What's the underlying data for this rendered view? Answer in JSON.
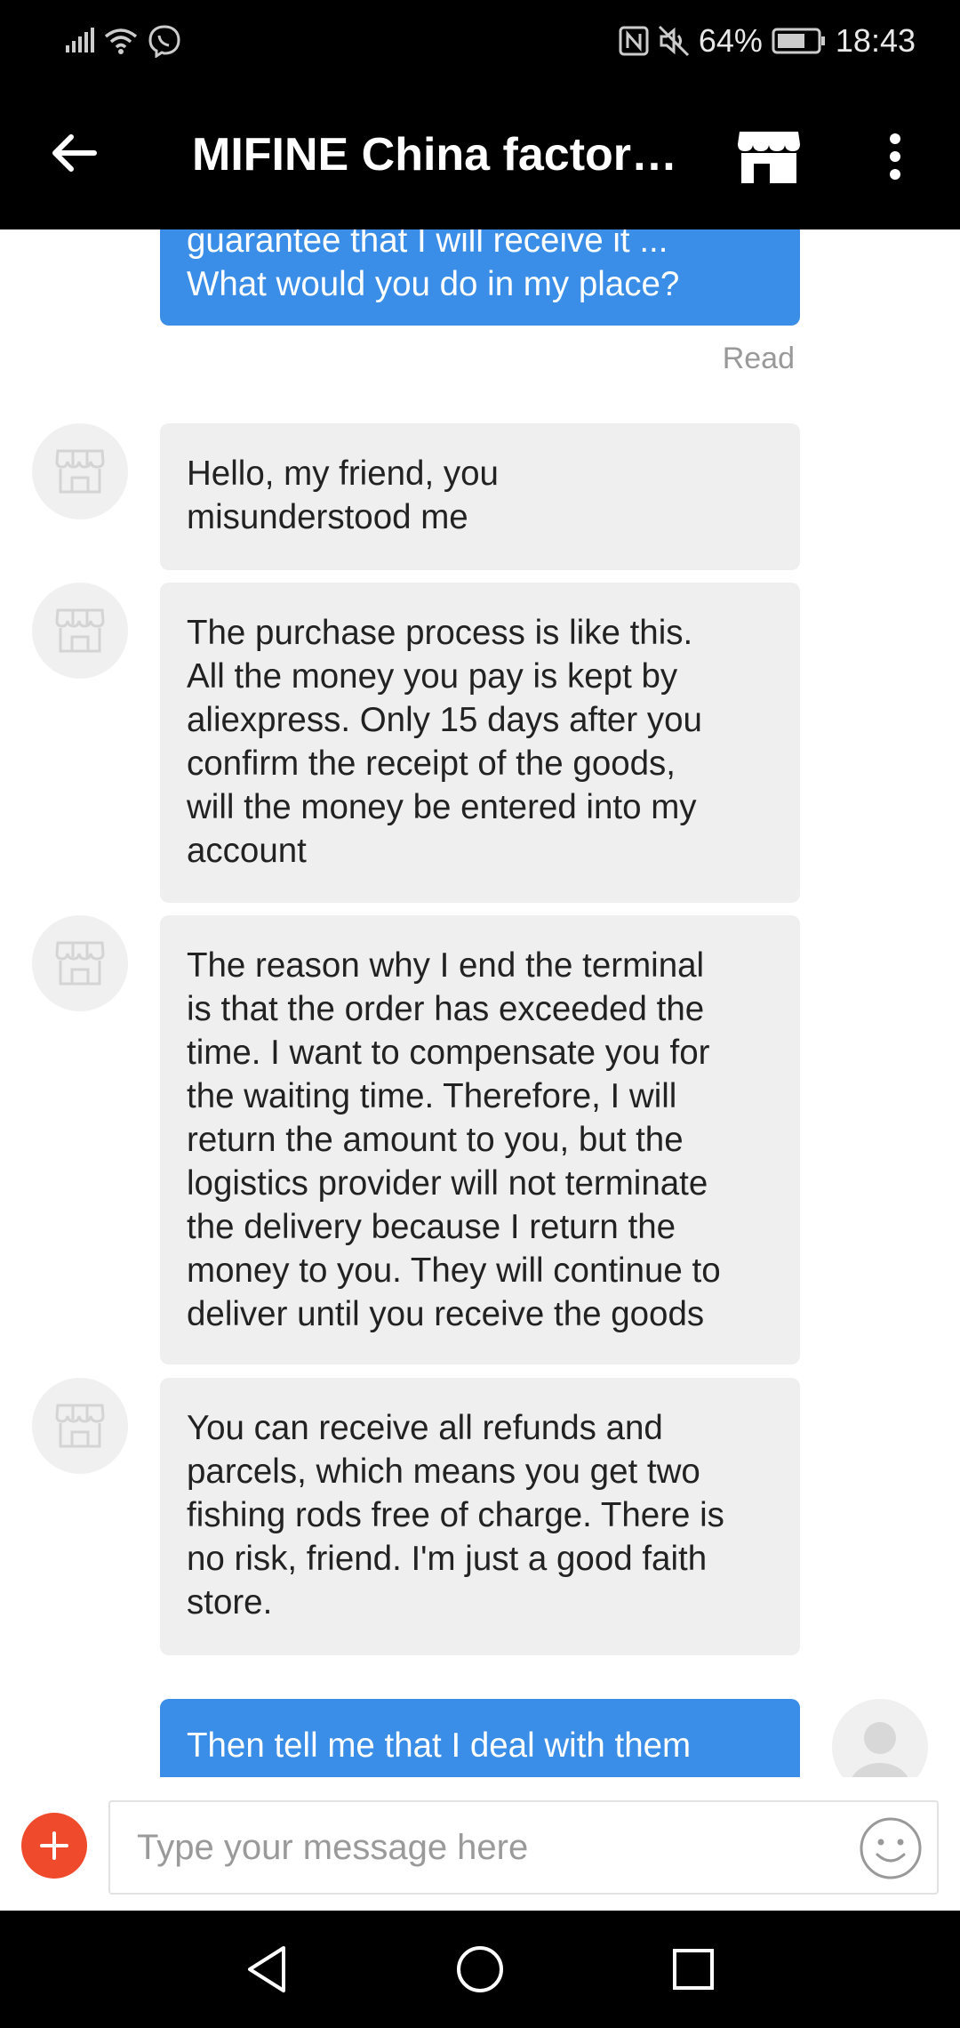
{
  "status_bar": {
    "battery": "64%",
    "time": "18:43",
    "icons": [
      "signal-icon",
      "wifi-icon",
      "viber-icon",
      "nfc-icon",
      "mute-icon",
      "battery-icon"
    ]
  },
  "header": {
    "title": "MIFINE China factory…",
    "icons": [
      "back-arrow-icon",
      "store-icon",
      "more-vert-icon"
    ]
  },
  "messages": [
    {
      "sender": "me",
      "lines": [
        "guarantee that I will receive it ...",
        "What would you do in my place?"
      ]
    },
    {
      "sender": "them",
      "lines": [
        "Hello, my friend, you",
        "misunderstood me"
      ]
    },
    {
      "sender": "them",
      "lines": [
        "The purchase process is like this.",
        "All the money you pay is kept by",
        "aliexpress. Only 15 days after you",
        "confirm the receipt of the goods,",
        "will the money be entered into my",
        "account"
      ]
    },
    {
      "sender": "them",
      "lines": [
        "The reason why I end the terminal",
        "is that the order has exceeded the",
        "time. I want to compensate you for",
        "the waiting time. Therefore, I will",
        "return the amount to you, but the",
        "logistics provider will not terminate",
        "the delivery because I return the",
        "money to you. They will continue to",
        "deliver until you receive the goods"
      ]
    },
    {
      "sender": "them",
      "lines": [
        "You can receive all refunds and",
        "parcels, which means you get two",
        "fishing rods free of charge. There is",
        "no risk, friend. I'm just a good faith",
        "store."
      ]
    },
    {
      "sender": "me",
      "lines": [
        "Then tell me that I deal with them"
      ]
    }
  ],
  "read_receipt": "Read",
  "composer": {
    "placeholder": "Type your message here",
    "icons": [
      "plus-icon",
      "emoji-icon"
    ]
  },
  "nav_bar": {
    "icons": [
      "nav-back-icon",
      "nav-home-icon",
      "nav-recents-icon"
    ]
  },
  "colors": {
    "my_bubble": "#3b8ee8",
    "their_bubble": "#efefef",
    "plus_button": "#f04a2c",
    "bars": "#000000"
  }
}
